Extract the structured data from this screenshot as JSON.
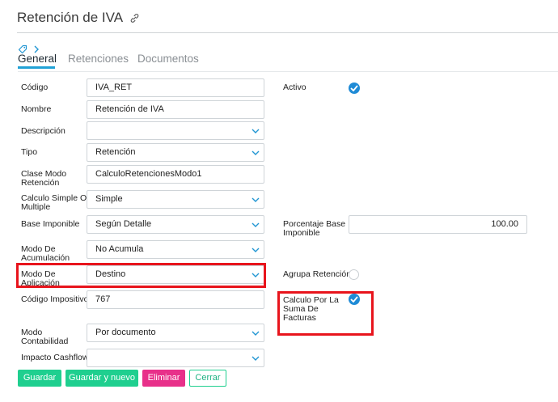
{
  "page": {
    "title": "Retención de IVA"
  },
  "tabs": [
    {
      "label": "General",
      "active": true
    },
    {
      "label": "Retenciones",
      "active": false
    },
    {
      "label": "Documentos",
      "active": false
    }
  ],
  "form": {
    "codigo": {
      "label": "Código",
      "value": "IVA_RET"
    },
    "nombre": {
      "label": "Nombre",
      "value": "Retención de IVA"
    },
    "descripcion": {
      "label": "Descripción",
      "value": ""
    },
    "tipo": {
      "label": "Tipo",
      "value": "Retención"
    },
    "clase_modo": {
      "label_1": "Clase Modo",
      "label_2": "Retención",
      "value": "CalculoRetencionesModo1"
    },
    "calculo_simple": {
      "label_1": "Calculo Simple O",
      "label_2": "Multiple",
      "value": "Simple"
    },
    "base_imponible": {
      "label": "Base Imponible",
      "value": "Según Detalle"
    },
    "modo_acumulacion": {
      "label_1": "Modo De",
      "label_2": "Acumulación",
      "value": "No Acumula"
    },
    "modo_aplicacion": {
      "label_1": "Modo De",
      "label_2": "Aplicación",
      "value": "Destino"
    },
    "codigo_impositivo": {
      "label": "Código Impositivo",
      "value": "767"
    },
    "modo_contabilidad": {
      "label_1": "Modo",
      "label_2": "Contabilidad",
      "value": "Por documento"
    },
    "impacto_cashflow": {
      "label": "Impacto Cashflow",
      "value": ""
    },
    "activo": {
      "label": "Activo",
      "checked": true
    },
    "porcentaje_base": {
      "label_1": "Porcentaje Base",
      "label_2": "Imponible",
      "value": "100.00"
    },
    "agrupa_retencion": {
      "label": "Agrupa Retención",
      "checked": false
    },
    "calculo_suma": {
      "label_1": "Calculo Por La",
      "label_2": "Suma De",
      "label_3": "Facturas",
      "checked": true
    }
  },
  "buttons": {
    "save": "Guardar",
    "save_new": "Guardar y nuevo",
    "delete": "Eliminar",
    "close": "Cerrar"
  },
  "colors": {
    "accent": "#1f8bd6",
    "tab_underline": "#21a2d6",
    "success": "#1fcf8f",
    "danger": "#e8308a",
    "highlight": "#e8141c"
  }
}
